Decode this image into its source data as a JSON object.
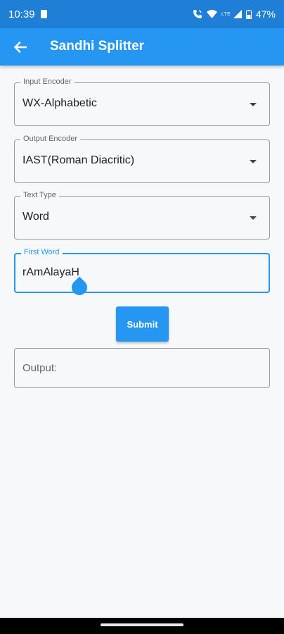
{
  "status_bar": {
    "time": "10:39",
    "network_label": "LTE",
    "battery": "47%",
    "icons": [
      "sim-card-icon",
      "wifi-calling-icon",
      "wifi-icon",
      "signal-icon",
      "battery-icon"
    ]
  },
  "app_bar": {
    "title": "Sandhi Splitter",
    "back_icon": "arrow-back-icon",
    "background": "#2696f3"
  },
  "form": {
    "input_encoder": {
      "label": "Input Encoder",
      "value": "WX-Alphabetic"
    },
    "output_encoder": {
      "label": "Output Encoder",
      "value": "IAST(Roman Diacritic)"
    },
    "text_type": {
      "label": "Text Type",
      "value": "Word"
    },
    "first_word": {
      "label": "First Word",
      "value": "rAmAlayaH"
    },
    "submit_label": "Submit",
    "output_label": "Output:"
  },
  "colors": {
    "accent": "#2696f3",
    "status_bar": "#1f7fd6"
  }
}
